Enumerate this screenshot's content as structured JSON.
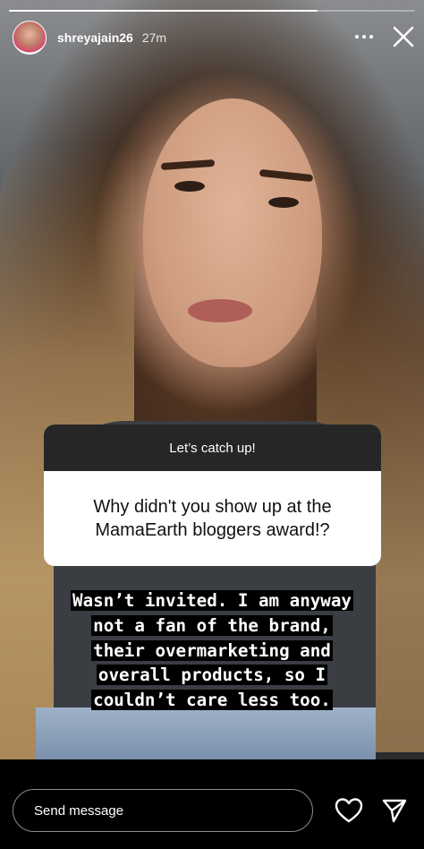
{
  "story": {
    "progress_fraction": 0.76,
    "username": "shreyajain26",
    "time_ago": "27m"
  },
  "question_sticker": {
    "title": "Let’s catch up!",
    "question": "Why didn't you show up at the MamaEarth bloggers award!?"
  },
  "caption": {
    "lines": [
      "Wasn’t invited. I am anyway",
      "not a fan of the brand,",
      "their overmarketing and",
      "overall products, so I",
      "couldn’t care less too."
    ]
  },
  "reply_bar": {
    "placeholder": "Send message"
  },
  "icons": {
    "more": "more-options-icon",
    "close": "close-icon",
    "like": "heart-icon",
    "send": "send-icon"
  }
}
